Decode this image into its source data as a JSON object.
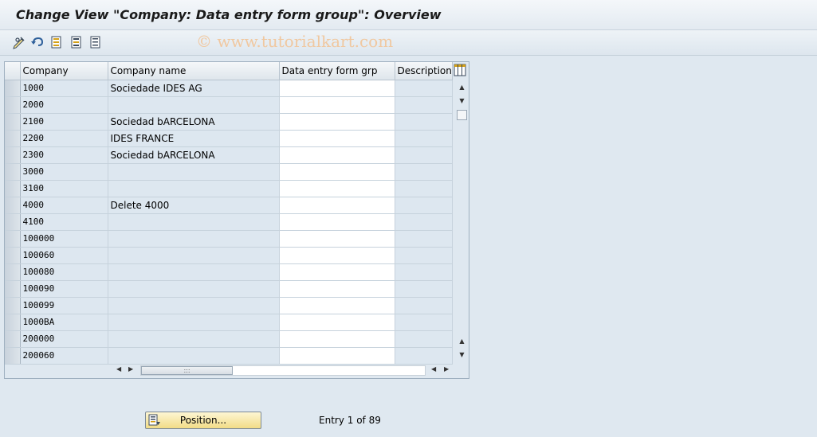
{
  "window": {
    "title": "Change View \"Company: Data entry form group\": Overview",
    "watermark": "© www.tutorialkart.com"
  },
  "toolbar": {
    "buttons": [
      {
        "icon": "change-display-icon"
      },
      {
        "icon": "undo-icon"
      },
      {
        "icon": "select-all-icon"
      },
      {
        "icon": "select-block-icon"
      },
      {
        "icon": "deselect-all-icon"
      }
    ]
  },
  "table": {
    "headers": {
      "company": "Company",
      "company_name": "Company name",
      "form_group": "Data entry form grp",
      "description": "Description"
    },
    "rows": [
      {
        "company": "1000",
        "name": "Sociedade IDES AG",
        "group": "",
        "description": ""
      },
      {
        "company": "2000",
        "name": "",
        "group": "",
        "description": ""
      },
      {
        "company": "2100",
        "name": "Sociedad bARCELONA",
        "group": "",
        "description": ""
      },
      {
        "company": "2200",
        "name": "IDES FRANCE",
        "group": "",
        "description": ""
      },
      {
        "company": "2300",
        "name": "Sociedad bARCELONA",
        "group": "",
        "description": ""
      },
      {
        "company": "3000",
        "name": "",
        "group": "",
        "description": ""
      },
      {
        "company": "3100",
        "name": "",
        "group": "",
        "description": ""
      },
      {
        "company": "4000",
        "name": "Delete 4000",
        "group": "",
        "description": ""
      },
      {
        "company": "4100",
        "name": "",
        "group": "",
        "description": ""
      },
      {
        "company": "100000",
        "name": "",
        "group": "",
        "description": ""
      },
      {
        "company": "100060",
        "name": "",
        "group": "",
        "description": ""
      },
      {
        "company": "100080",
        "name": "",
        "group": "",
        "description": ""
      },
      {
        "company": "100090",
        "name": "",
        "group": "",
        "description": ""
      },
      {
        "company": "100099",
        "name": "",
        "group": "",
        "description": ""
      },
      {
        "company": "1000BA",
        "name": "",
        "group": "",
        "description": ""
      },
      {
        "company": "200000",
        "name": "",
        "group": "",
        "description": ""
      },
      {
        "company": "200060",
        "name": "",
        "group": "",
        "description": ""
      }
    ]
  },
  "footer": {
    "position_button": "Position...",
    "entry_info": "Entry 1 of 89"
  },
  "colors": {
    "accent_button": "#f2dc86",
    "table_cell_readonly": "#dde7f0",
    "background": "#dfe8f0"
  }
}
